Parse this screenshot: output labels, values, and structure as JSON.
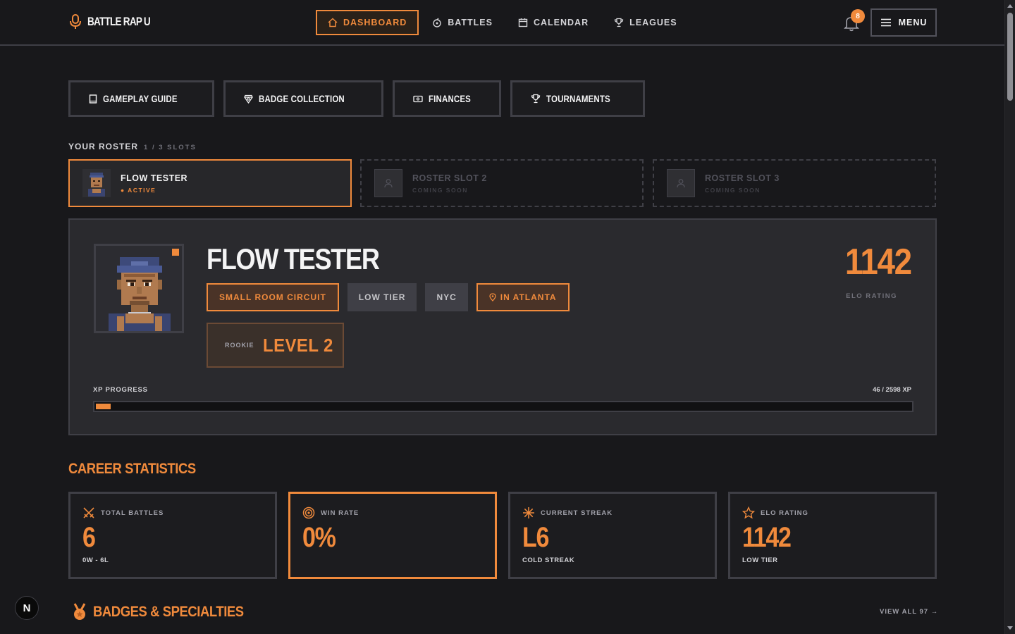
{
  "brand": {
    "name": "BATTLE RAP U"
  },
  "nav": {
    "items": [
      {
        "label": "DASHBOARD",
        "icon": "home-icon",
        "active": true
      },
      {
        "label": "BATTLES",
        "icon": "battles-icon",
        "active": false
      },
      {
        "label": "CALENDAR",
        "icon": "calendar-icon",
        "active": false
      },
      {
        "label": "LEAGUES",
        "icon": "trophy-icon",
        "active": false
      }
    ],
    "notifications": "8",
    "menu_label": "MENU"
  },
  "quick_actions": [
    {
      "label": "GAMEPLAY GUIDE",
      "icon": "book-icon"
    },
    {
      "label": "BADGE COLLECTION",
      "icon": "badge-icon"
    },
    {
      "label": "FINANCES",
      "icon": "wallet-icon"
    },
    {
      "label": "TOURNAMENTS",
      "icon": "trophy-icon"
    }
  ],
  "roster": {
    "label": "YOUR ROSTER",
    "slots_text": "1 / 3 SLOTS",
    "slots": [
      {
        "name": "FLOW TESTER",
        "status": "● ACTIVE"
      },
      {
        "name": "ROSTER SLOT 2",
        "status": "COMING SOON"
      },
      {
        "name": "ROSTER SLOT 3",
        "status": "COMING SOON"
      }
    ]
  },
  "profile": {
    "name": "FLOW TESTER",
    "tags": [
      "SMALL ROOM CIRCUIT",
      "LOW TIER",
      "NYC",
      "IN ATLANTA"
    ],
    "rank": "ROOKIE",
    "level": "LEVEL 2",
    "elo": "1142",
    "elo_label": "ELO RATING",
    "xp_label": "XP PROGRESS",
    "xp_text": "46 / 2598 XP",
    "xp_fraction": 0.0177
  },
  "career": {
    "title": "CAREER STATISTICS",
    "stats": [
      {
        "label": "TOTAL BATTLES",
        "value": "6",
        "sub": "0W - 6L",
        "icon": "swords-icon"
      },
      {
        "label": "WIN RATE",
        "value": "0%",
        "sub": "",
        "icon": "target-icon"
      },
      {
        "label": "CURRENT STREAK",
        "value": "L6",
        "sub": "COLD STREAK",
        "icon": "snowflake-icon"
      },
      {
        "label": "ELO RATING",
        "value": "1142",
        "sub": "LOW TIER",
        "icon": "star-icon"
      }
    ]
  },
  "badges": {
    "title": "BADGES & SPECIALTIES",
    "view_all": "VIEW ALL 97 →"
  },
  "colors": {
    "accent": "#f08a3c",
    "background": "#18181b",
    "card": "#2a2a2e"
  }
}
